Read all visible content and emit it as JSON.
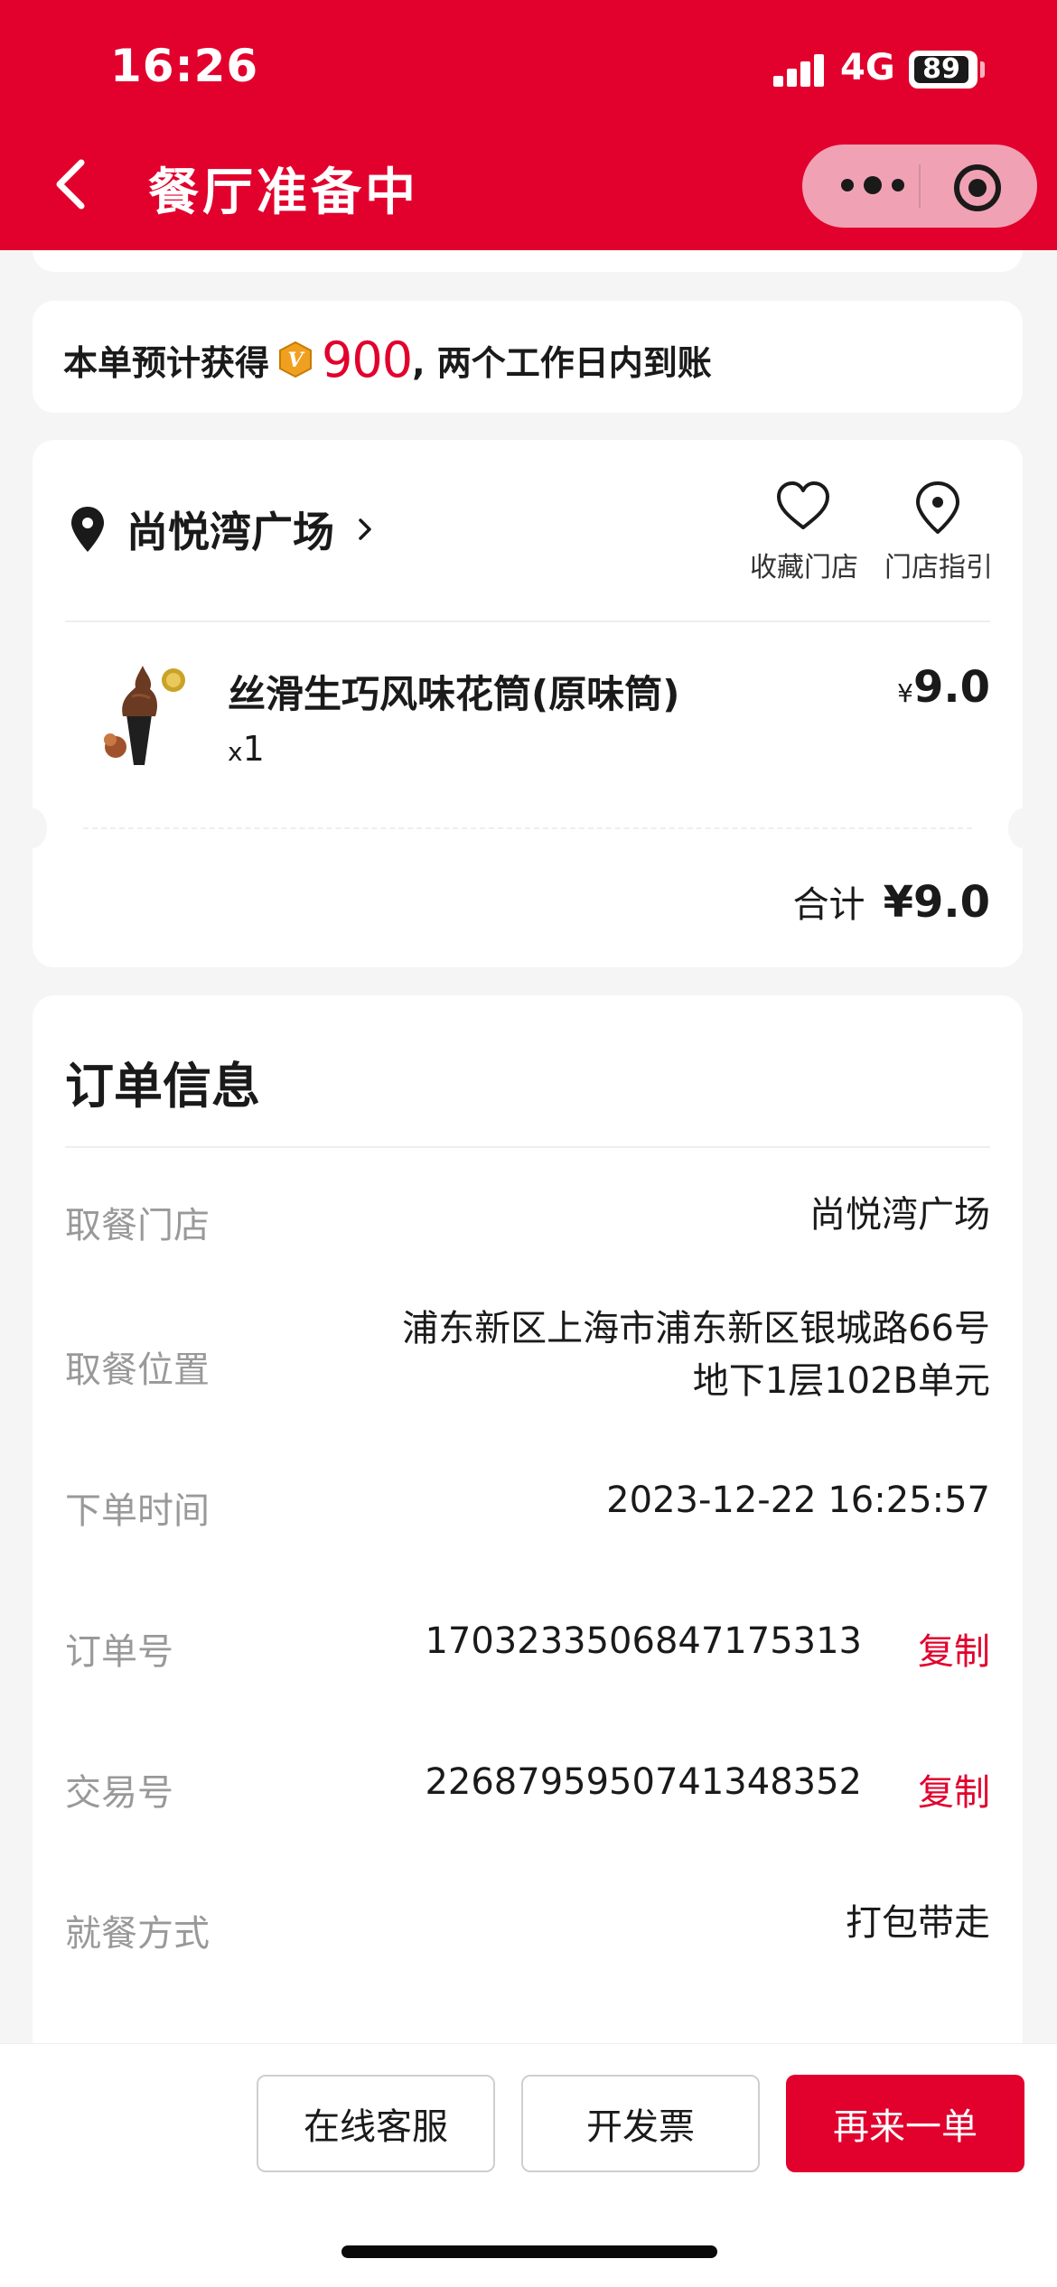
{
  "status_bar": {
    "time": "16:26",
    "network": "4G",
    "battery": "89"
  },
  "nav": {
    "title": "餐厅准备中"
  },
  "points": {
    "prefix": "本单预计获得",
    "amount": "900",
    "suffix": ", 两个工作日内到账",
    "coin_letter": "V"
  },
  "store": {
    "name": "尚悦湾广场",
    "favorite_label": "收藏门店",
    "guide_label": "门店指引"
  },
  "item": {
    "name": "丝滑生巧风味花筒(原味筒)",
    "qty_prefix": "x",
    "qty": "1",
    "currency": "¥",
    "price": "9.0"
  },
  "total": {
    "label": "合计",
    "amount": "¥9.0"
  },
  "order_info": {
    "title": "订单信息",
    "copy_label": "复制",
    "rows": [
      {
        "label": "取餐门店",
        "value": "尚悦湾广场"
      },
      {
        "label": "取餐位置",
        "value_line1": "浦东新区上海市浦东新区银城路66号",
        "value_line2": "地下1层102B单元"
      },
      {
        "label": "下单时间",
        "value": "2023-12-22 16:25:57"
      },
      {
        "label": "订单号",
        "value": "1703233506847175313"
      },
      {
        "label": "交易号",
        "value": "2268795950741348352"
      },
      {
        "label": "就餐方式",
        "value": "打包带走"
      }
    ]
  },
  "actions": {
    "service": "在线客服",
    "invoice": "开发票",
    "reorder": "再来一单"
  },
  "colors": {
    "brand": "#e2002d",
    "capsule": "#f0a2b4",
    "background": "#f5f5f5"
  }
}
